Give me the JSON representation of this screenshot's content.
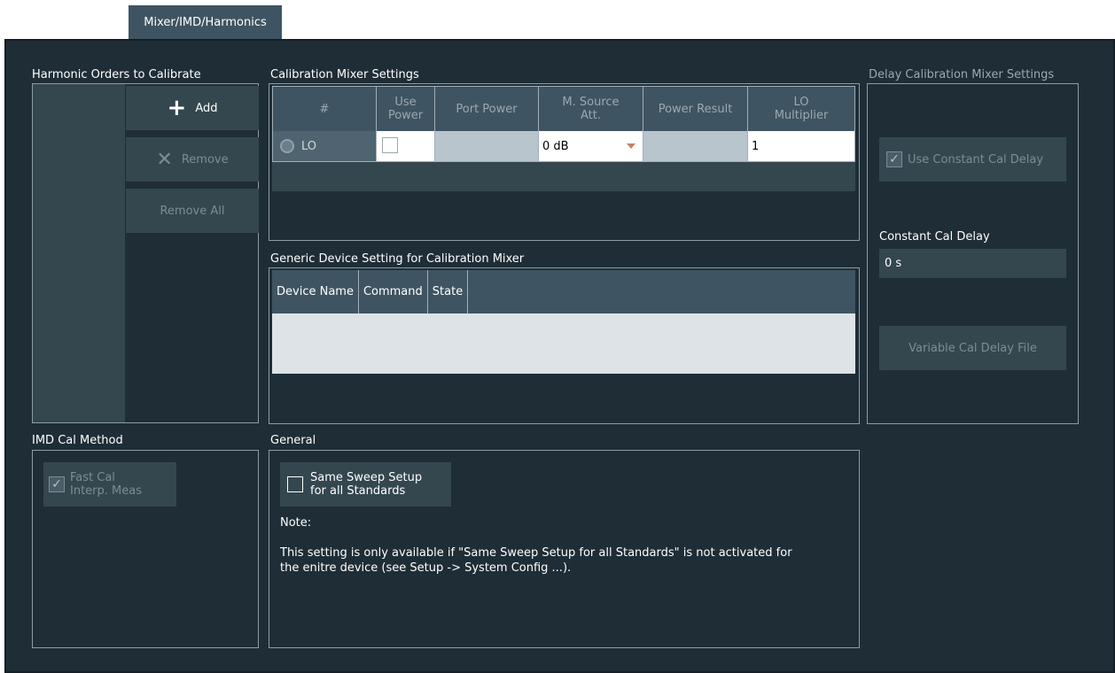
{
  "tab": {
    "label": "Mixer/IMD/Harmonics"
  },
  "harmonic": {
    "title": "Harmonic Orders to Calibrate",
    "add_label": "Add",
    "remove_label": "Remove",
    "remove_all_label": "Remove All"
  },
  "cal_mixer": {
    "title": "Calibration Mixer Settings",
    "columns": [
      "#",
      "Use Power",
      "Port Power",
      "M. Source Att.",
      "Power Result",
      "LO Multiplier"
    ],
    "row": {
      "name": "LO",
      "use_power": false,
      "port_power": "",
      "m_source_att": "0 dB",
      "power_result": "",
      "lo_multiplier": "1"
    }
  },
  "generic_device": {
    "title": "Generic Device Setting for Calibration Mixer",
    "columns": [
      "Device Name",
      "Command",
      "State"
    ]
  },
  "delay": {
    "title": "Delay Calibration Mixer Settings",
    "use_constant_label": "Use Constant Cal Delay",
    "constant_label": "Constant Cal Delay",
    "constant_value": "0 s",
    "variable_file_label": "Variable Cal Delay File"
  },
  "imd": {
    "title": "IMD Cal Method",
    "fast_cal_label_1": "Fast Cal",
    "fast_cal_label_2": "Interp. Meas"
  },
  "general": {
    "title": "General",
    "same_sweep_label_1": "Same Sweep Setup",
    "same_sweep_label_2": "for all Standards",
    "note_title": "Note:",
    "note_line_1": "This setting is only available if \"Same Sweep Setup for all Standards\" is not activated for",
    "note_line_2": "the enitre device (see Setup -> System Config ...)."
  }
}
